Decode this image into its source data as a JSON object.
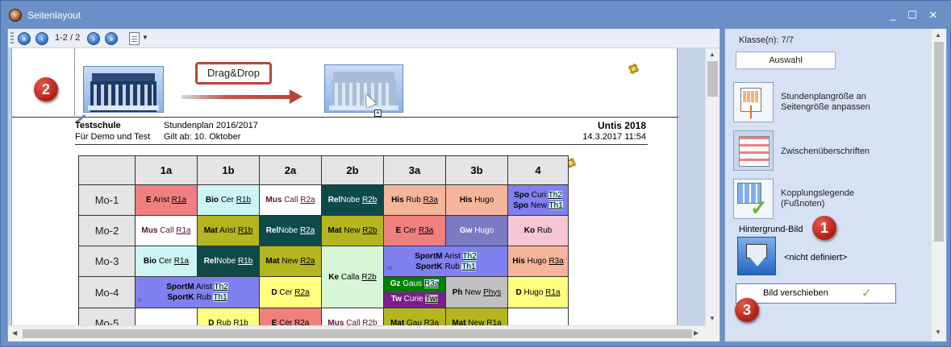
{
  "window": {
    "title": "Seitenlayout",
    "controls": {
      "minimize": "_",
      "maximize": "☐",
      "close": "✕"
    }
  },
  "toolbar": {
    "first": "«",
    "prev": "‹",
    "next": "›",
    "last": "»",
    "page_info": "1-2 / 2"
  },
  "header": {
    "drag_drop": "Drag&Drop",
    "plus": "+"
  },
  "badges": {
    "one": "1",
    "two": "2",
    "three": "3"
  },
  "school": {
    "name": "Testschule",
    "sub": "Für Demo und Test",
    "plan": "Stundenplan 2016/2017",
    "valid": "Gilt ab: 10. Oktober",
    "product": "Untis 2018",
    "datetime": "14.3.2017  11:54"
  },
  "timetable": {
    "classes": [
      "1a",
      "1b",
      "2a",
      "2b",
      "3a",
      "3b",
      "4"
    ],
    "rows": [
      "Mo-1",
      "Mo-2",
      "Mo-3",
      "Mo-4",
      "Mo-5"
    ]
  },
  "cells": {
    "mo1_1a": {
      "s": "E",
      "t": "Arist",
      "r": "R1a"
    },
    "mo1_1b": {
      "s": "Bio",
      "t": "Cer",
      "r": "R1b"
    },
    "mo1_2a": {
      "s": "Mus",
      "t": "Call",
      "r": "R2a"
    },
    "mo1_2b": {
      "s": "Rel",
      "t": "Nobe",
      "r": "R2b"
    },
    "mo1_3a": {
      "s": "His",
      "t": "Rub",
      "r": "R3a"
    },
    "mo1_3b": {
      "s": "His",
      "t": "Hugo",
      "r": ""
    },
    "mo1_4a": {
      "s": "Spo",
      "t": "Curi",
      "r": "Th2"
    },
    "mo1_4b": {
      "s": "Spo",
      "t": "New",
      "r": "Th1"
    },
    "mo2_1a": {
      "s": "Mus",
      "t": "Call",
      "r": "R1a"
    },
    "mo2_1b": {
      "s": "Mat",
      "t": "Arist",
      "r": "R1b"
    },
    "mo2_2a": {
      "s": "Rel",
      "t": "Nobe",
      "r": "R2a"
    },
    "mo2_2b": {
      "s": "Mat",
      "t": "New",
      "r": "R2b"
    },
    "mo2_3a": {
      "s": "E",
      "t": "Cer",
      "r": "R3a"
    },
    "mo2_3b": {
      "s": "Gw",
      "t": "Hugo",
      "r": ""
    },
    "mo2_4": {
      "s": "Ko",
      "t": "Rub",
      "r": ""
    },
    "mo3_1a": {
      "s": "Bio",
      "t": "Cer",
      "r": "R1a"
    },
    "mo3_1b": {
      "s": "Rel",
      "t": "Nobe",
      "r": "R1b"
    },
    "mo3_2a": {
      "s": "Mat",
      "t": "New",
      "r": "R2a"
    },
    "mo3_2b": {
      "s": "Ke",
      "t": "Calla",
      "r": "R2b"
    },
    "mo3_3ab_a": {
      "s": "SportM",
      "t": "Arist",
      "r": "Th2"
    },
    "mo3_3ab_b": {
      "s": "SportK",
      "t": "Rub",
      "r": "Th1"
    },
    "mo3_3ab_fn": "10)",
    "mo3_4": {
      "s": "His",
      "t": "Hugo",
      "r": "R3a"
    },
    "mo4_1ab_a": {
      "s": "SportM",
      "t": "Arist",
      "r": "Th2"
    },
    "mo4_1ab_b": {
      "s": "SportK",
      "t": "Rub",
      "r": "Th1"
    },
    "mo4_1ab_fn": "1)",
    "mo4_2a": {
      "s": "D",
      "t": "Cer",
      "r": "R2a"
    },
    "mo4_3a_a": {
      "s": "Gz",
      "t": "Gaus",
      "r": "R3a"
    },
    "mo4_3a_b": {
      "s": "Tw",
      "t": "Curie",
      "r": "Twr"
    },
    "mo4_3b": {
      "s": "Ph",
      "t": "New",
      "r": "Phys"
    },
    "mo4_4": {
      "s": "D",
      "t": "Hugo",
      "r": "R1a"
    },
    "mo5_1b": {
      "s": "D",
      "t": "Rub",
      "r": "R1b"
    },
    "mo5_2a": {
      "s": "E",
      "t": "Cer",
      "r": "R2a"
    },
    "mo5_2b": {
      "s": "Mus",
      "t": "Call",
      "r": "R2b"
    },
    "mo5_3a": {
      "s": "Mat",
      "t": "Gau",
      "r": "R3a"
    },
    "mo5_3b": {
      "s": "Mat",
      "t": "New",
      "r": "R1a"
    }
  },
  "sidebar": {
    "klasse": "Klasse(n): 7/7",
    "auswahl": "Auswahl",
    "fit_label_1": "Stundenplangröße an",
    "fit_label_2": "Seitengröße anpassen",
    "zwischen": "Zwischenüberschriften",
    "kopplung_1": "Kopplungslegende",
    "kopplung_2": "(Fußnoten)",
    "hintergrund": "Hintergrund-Bild",
    "nicht_def": "<nicht definiert>",
    "bild_verschieben": "Bild verschieben",
    "check": "✓"
  },
  "colors": {
    "salmon": "#f08080",
    "lightcyan": "#ccf5f5",
    "white": "#ffffff",
    "darkteal": "#0f4a4a",
    "peach": "#f5b59a",
    "pink": "#f5c6d6",
    "olive": "#b5b520",
    "slate": "#7b7bc4",
    "blue": "#8080f0",
    "yellow": "#ffff80",
    "green": "#008000",
    "purple": "#7a1f8a",
    "gray": "#c0c0c0",
    "mint": "#d7f5d7"
  }
}
